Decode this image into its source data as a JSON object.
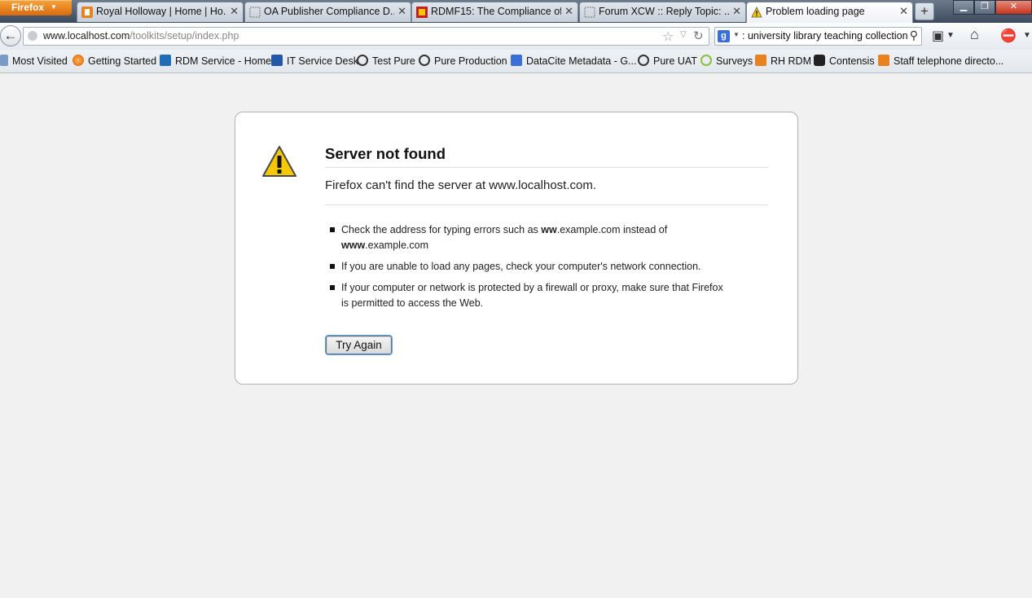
{
  "browser": {
    "app_menu_label": "Firefox",
    "tabs": [
      {
        "title": "Royal Holloway | Home | Ho...",
        "icon": "rh-favicon",
        "active": false
      },
      {
        "title": "OA Publisher Compliance D...",
        "icon": "blank-page-icon",
        "active": false
      },
      {
        "title": "RDMF15: The Compliance of...",
        "icon": "rdmf-favicon",
        "active": false
      },
      {
        "title": "Forum XCW :: Reply Topic: ...",
        "icon": "blank-page-icon",
        "active": false
      },
      {
        "title": "Problem loading page",
        "icon": "warning-icon",
        "active": true
      }
    ],
    "new_tab_label": "+",
    "url_host": "www.localhost.com",
    "url_path": "/toolkits/setup/index.php",
    "search_query": ": university library teaching collection",
    "bookmarks": [
      {
        "label": "Most Visited"
      },
      {
        "label": "Getting Started"
      },
      {
        "label": "RDM Service - Home"
      },
      {
        "label": "IT Service Desk"
      },
      {
        "label": "Test Pure"
      },
      {
        "label": "Pure Production"
      },
      {
        "label": "DataCite Metadata - G..."
      },
      {
        "label": "Pure UAT"
      },
      {
        "label": "Surveys"
      },
      {
        "label": "RH RDM"
      },
      {
        "label": "Contensis"
      },
      {
        "label": "Staff telephone directo..."
      }
    ]
  },
  "error": {
    "title": "Server not found",
    "description": "Firefox can't find the server at www.localhost.com.",
    "hints": [
      {
        "pre": "Check the address for typing errors such as ",
        "b1": "ww",
        "mid": ".example.com instead of ",
        "b2": "www",
        "post": ".example.com"
      },
      {
        "text": "If you are unable to load any pages, check your computer's network connection."
      },
      {
        "text": "If your computer or network is protected by a firewall or proxy, make sure that Firefox is permitted to access the Web."
      }
    ],
    "try_again_label": "Try Again"
  },
  "colors": {
    "page_background": "#f1f1f1",
    "firefox_orange": "#e8811f",
    "warning_yellow": "#f5c800"
  }
}
